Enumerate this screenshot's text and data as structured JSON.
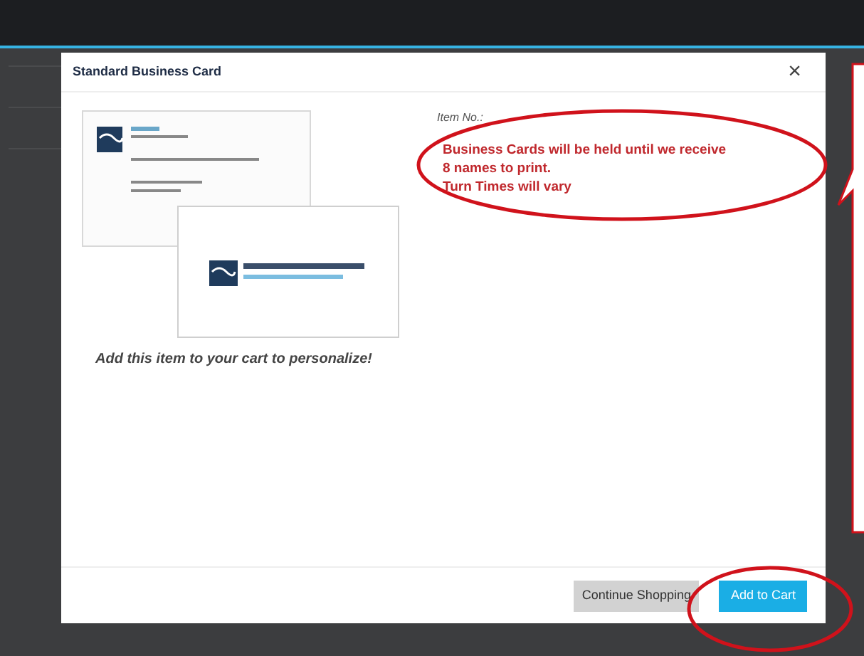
{
  "dialog": {
    "title": "Standard Business Card",
    "close": "×"
  },
  "product": {
    "caption": "Add this item to your cart to personalize!"
  },
  "details": {
    "item_label": "Item No.:",
    "notice": [
      "Business Cards will be held until we receive",
      "8 names to print.",
      "Turn Times will vary"
    ]
  },
  "buttons": [
    {
      "label": "Continue Shopping",
      "kind": "secondary"
    },
    {
      "label": "Add to Cart",
      "kind": "primary"
    }
  ]
}
